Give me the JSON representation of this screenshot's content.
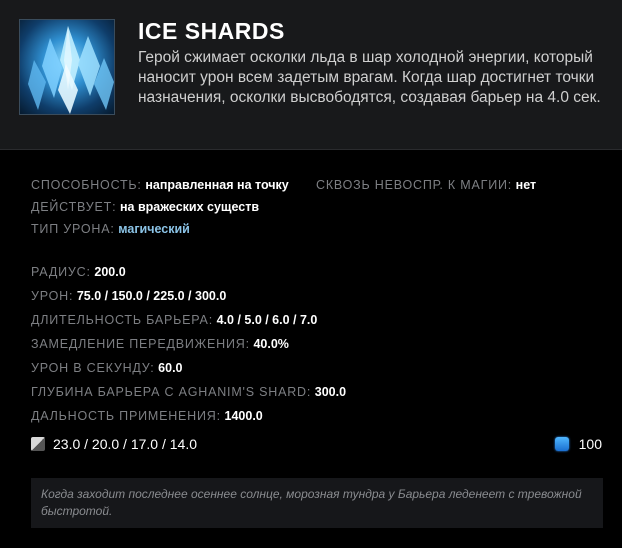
{
  "ability": {
    "name": "ICE SHARDS",
    "icon": "ice-crystal-icon",
    "description": "Герой сжимает осколки льда в шар холодной энергии, который наносит урон всем задетым врагам. Когда шар достигнет точки назначения, осколки высвободятся, создавая барьер на 4.0 сек."
  },
  "properties": {
    "ability_label": "СПОСОБНОСТЬ:",
    "ability_value": "направленная на точку",
    "bkb_label": "СКВОЗЬ НЕВОСПР. К МАГИИ:",
    "bkb_value": "нет",
    "affects_label": "ДЕЙСТВУЕТ:",
    "affects_value": "на вражеских существ",
    "damage_type_label": "ТИП УРОНА:",
    "damage_type_value": "магический"
  },
  "stats": [
    {
      "label": "РАДИУС:",
      "value": "200.0"
    },
    {
      "label": "УРОН:",
      "value": "75.0 / 150.0 / 225.0 / 300.0"
    },
    {
      "label": "ДЛИТЕЛЬНОСТЬ БАРЬЕРА:",
      "value": "4.0 / 5.0 / 6.0 / 7.0"
    },
    {
      "label": "ЗАМЕДЛЕНИЕ ПЕРЕДВИЖЕНИЯ:",
      "value": "40.0%"
    },
    {
      "label": "УРОН В СЕКУНДУ:",
      "value": "60.0"
    },
    {
      "label": "ГЛУБИНА БАРЬЕРА С AGHANIM'S SHARD:",
      "value": "300.0"
    },
    {
      "label": "ДАЛЬНОСТЬ ПРИМЕНЕНИЯ:",
      "value": "1400.0"
    }
  ],
  "costs": {
    "cooldown_icon": "cooldown-icon",
    "cooldown": "23.0 / 20.0 / 17.0 / 14.0",
    "mana_icon": "mana-icon",
    "mana": "100"
  },
  "lore": "Когда заходит последнее осеннее солнце, морозная тундра у Барьера леденеет с тревожной быстротой.",
  "colors": {
    "header_bg": "#18191b",
    "body_bg": "#000000",
    "magic_damage": "#8bc3e6",
    "mana": "#2d8cf0"
  }
}
